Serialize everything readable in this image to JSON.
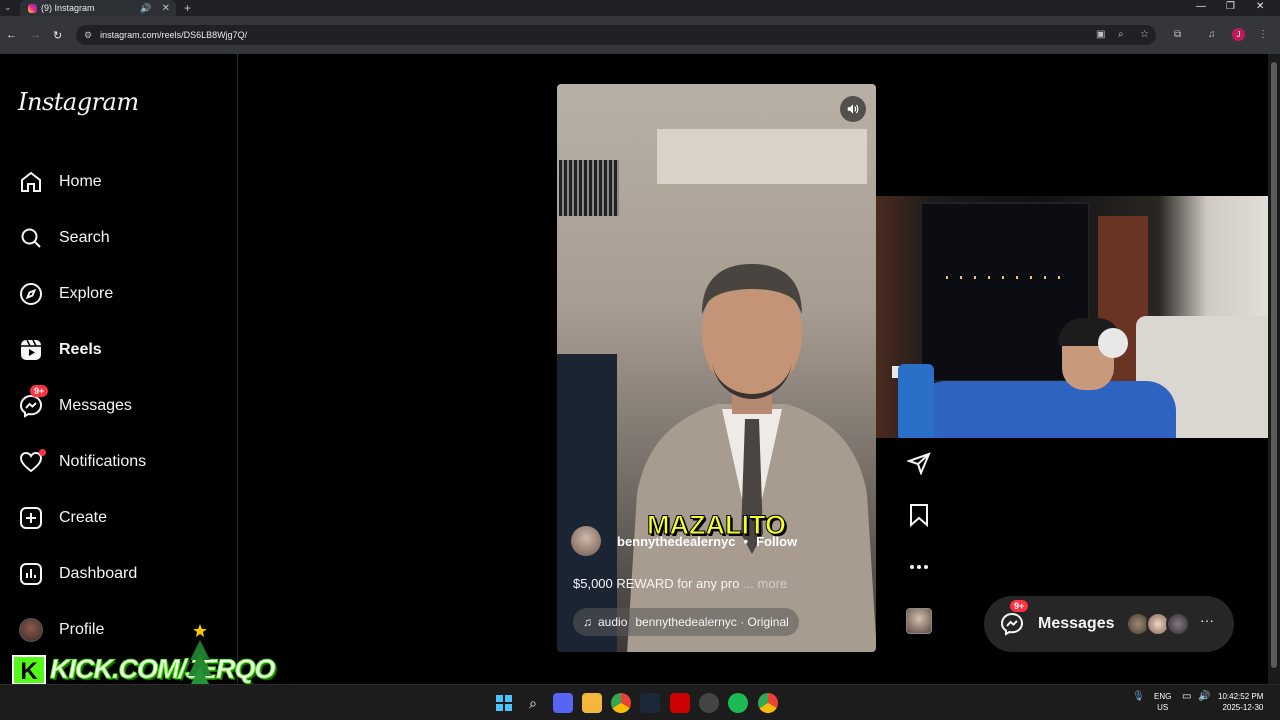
{
  "browser": {
    "tab_title": "(9) Instagram",
    "new_tab": "+",
    "url": "instagram.com/reels/DS6LB8Wjg7Q/"
  },
  "sidebar": {
    "logo": "Instagram",
    "items": [
      {
        "label": "Home",
        "icon": "home-icon"
      },
      {
        "label": "Search",
        "icon": "search-icon"
      },
      {
        "label": "Explore",
        "icon": "compass-icon"
      },
      {
        "label": "Reels",
        "icon": "reels-icon",
        "active": true
      },
      {
        "label": "Messages",
        "icon": "messenger-icon",
        "badge": "9+"
      },
      {
        "label": "Notifications",
        "icon": "heart-icon",
        "dot": true
      },
      {
        "label": "Create",
        "icon": "plus-square-icon"
      },
      {
        "label": "Dashboard",
        "icon": "chart-icon"
      },
      {
        "label": "Profile",
        "icon": "profile-avatar"
      }
    ]
  },
  "reel": {
    "caption_overlay": "MAZALITO",
    "author": "bennythedealernyc",
    "separator": "•",
    "follow": "Follow",
    "description": "$5,000 REWARD for any pro",
    "more": "... more",
    "audio_label": "audio",
    "audio_text": "bennythedealernyc · Original"
  },
  "messages_pill": {
    "label": "Messages",
    "badge": "9+",
    "more": "···"
  },
  "overlay": {
    "kick_text": "KICK.COM/JERQO",
    "kick_logo": "K"
  },
  "taskbar": {
    "lang": "ENG",
    "region": "US",
    "time": "10:42:52 PM",
    "date": "2025-12-30"
  },
  "colors": {
    "accent_badge": "#ff3040",
    "caption_yellow": "#f3ff2b",
    "kick_green": "#53fc18"
  }
}
